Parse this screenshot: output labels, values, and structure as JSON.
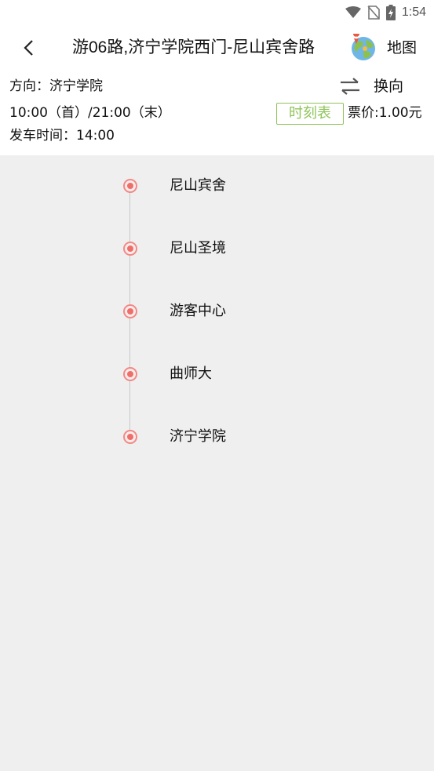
{
  "status_bar": {
    "time": "1:54",
    "icons": [
      "wifi-icon",
      "no-sim-icon",
      "battery-charging-icon"
    ]
  },
  "header": {
    "back_icon": "chevron-left-icon",
    "title": "游06路,济宁学院西门-尼山宾舍路",
    "map_icon": "globe-map-icon",
    "map_label": "地图"
  },
  "route_info": {
    "direction": "方向：济宁学院",
    "swap_icon": "swap-arrows-icon",
    "swap_label": "换向",
    "hours": "10:00（首）/21:00（末）",
    "timetable_label": "时刻表",
    "fare": "票价:1.00元",
    "departure": "发车时间：14:00"
  },
  "stops": [
    {
      "name": "尼山宾舍"
    },
    {
      "name": "尼山圣境"
    },
    {
      "name": "游客中心"
    },
    {
      "name": "曲师大"
    },
    {
      "name": "济宁学院"
    }
  ],
  "colors": {
    "accent_green": "#8fc45a",
    "stop_dot": "#ec6f6b",
    "background": "#efefef"
  }
}
